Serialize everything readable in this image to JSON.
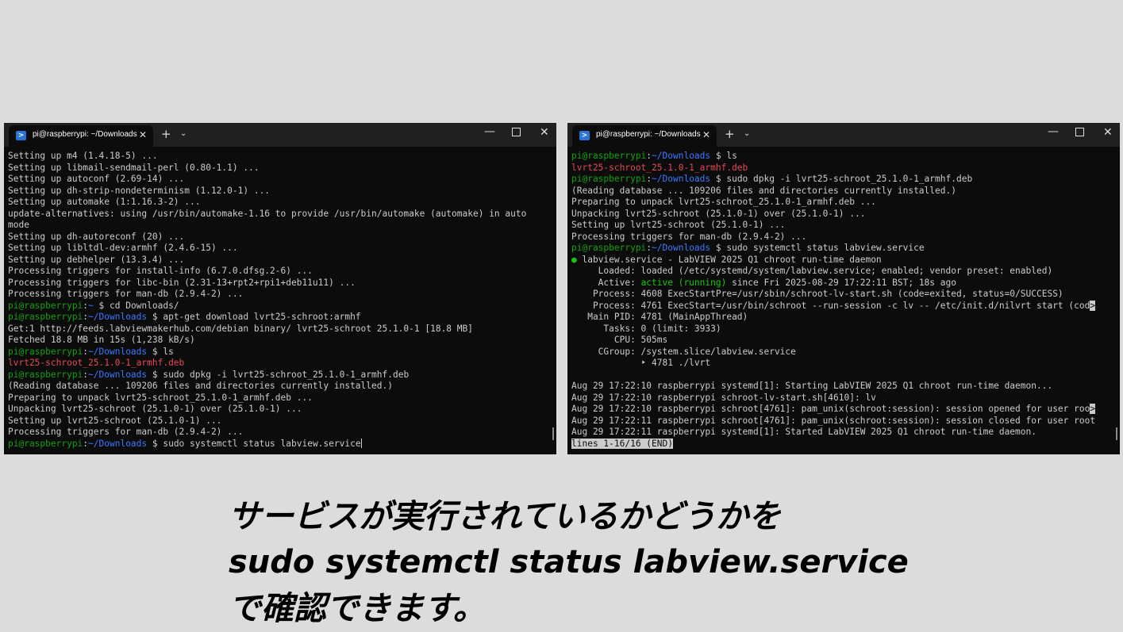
{
  "left_window": {
    "tab_title": "pi@raspberrypi: ~/Downloads",
    "tab_close": "✕",
    "new_tab": "+",
    "tab_menu": "⌄",
    "lines": [
      [
        {
          "t": "Setting up m4 (1.4.18-5) ...",
          "c": "w"
        }
      ],
      [
        {
          "t": "Setting up libmail-sendmail-perl (0.80-1.1) ...",
          "c": "w"
        }
      ],
      [
        {
          "t": "Setting up autoconf (2.69-14) ...",
          "c": "w"
        }
      ],
      [
        {
          "t": "Setting up dh-strip-nondeterminism (1.12.0-1) ...",
          "c": "w"
        }
      ],
      [
        {
          "t": "Setting up automake (1:1.16.3-2) ...",
          "c": "w"
        }
      ],
      [
        {
          "t": "update-alternatives: using /usr/bin/automake-1.16 to provide /usr/bin/automake (automake) in auto",
          "c": "w"
        }
      ],
      [
        {
          "t": "mode",
          "c": "w"
        }
      ],
      [
        {
          "t": "Setting up dh-autoreconf (20) ...",
          "c": "w"
        }
      ],
      [
        {
          "t": "Setting up libltdl-dev:armhf (2.4.6-15) ...",
          "c": "w"
        }
      ],
      [
        {
          "t": "Setting up debhelper (13.3.4) ...",
          "c": "w"
        }
      ],
      [
        {
          "t": "Processing triggers for install-info (6.7.0.dfsg.2-6) ...",
          "c": "w"
        }
      ],
      [
        {
          "t": "Processing triggers for libc-bin (2.31-13+rpt2+rpi1+deb11u11) ...",
          "c": "w"
        }
      ],
      [
        {
          "t": "Processing triggers for man-db (2.9.4-2) ...",
          "c": "w"
        }
      ],
      [
        {
          "t": "pi@raspberrypi",
          "c": "g"
        },
        {
          "t": ":",
          "c": "w"
        },
        {
          "t": "~",
          "c": "b"
        },
        {
          "t": " $ cd Downloads/",
          "c": "w"
        }
      ],
      [
        {
          "t": "pi@raspberrypi",
          "c": "g"
        },
        {
          "t": ":",
          "c": "w"
        },
        {
          "t": "~/Downloads",
          "c": "b"
        },
        {
          "t": " $ apt-get download lvrt25-schroot:armhf",
          "c": "w"
        }
      ],
      [
        {
          "t": "Get:1 http://feeds.labviewmakerhub.com/debian binary/ lvrt25-schroot 25.1.0-1 [18.8 MB]",
          "c": "w"
        }
      ],
      [
        {
          "t": "Fetched 18.8 MB in 15s (1,238 kB/s)",
          "c": "w"
        }
      ],
      [
        {
          "t": "pi@raspberrypi",
          "c": "g"
        },
        {
          "t": ":",
          "c": "w"
        },
        {
          "t": "~/Downloads",
          "c": "b"
        },
        {
          "t": " $ ls",
          "c": "w"
        }
      ],
      [
        {
          "t": "lvrt25-schroot_25.1.0-1_armhf.deb",
          "c": "r"
        }
      ],
      [
        {
          "t": "pi@raspberrypi",
          "c": "g"
        },
        {
          "t": ":",
          "c": "w"
        },
        {
          "t": "~/Downloads",
          "c": "b"
        },
        {
          "t": " $ sudo dpkg -i lvrt25-schroot_25.1.0-1_armhf.deb",
          "c": "w"
        }
      ],
      [
        {
          "t": "(Reading database ... 109206 files and directories currently installed.)",
          "c": "w"
        }
      ],
      [
        {
          "t": "Preparing to unpack lvrt25-schroot_25.1.0-1_armhf.deb ...",
          "c": "w"
        }
      ],
      [
        {
          "t": "Unpacking lvrt25-schroot (25.1.0-1) over (25.1.0-1) ...",
          "c": "w"
        }
      ],
      [
        {
          "t": "Setting up lvrt25-schroot (25.1.0-1) ...",
          "c": "w"
        }
      ],
      [
        {
          "t": "Processing triggers for man-db (2.9.4-2) ...",
          "c": "w"
        }
      ],
      [
        {
          "t": "pi@raspberrypi",
          "c": "g"
        },
        {
          "t": ":",
          "c": "w"
        },
        {
          "t": "~/Downloads",
          "c": "b"
        },
        {
          "t": " $ sudo systemctl status labview.service",
          "c": "w"
        },
        {
          "t": "",
          "c": "cursor"
        }
      ]
    ]
  },
  "right_window": {
    "tab_title": "pi@raspberrypi: ~/Downloads",
    "tab_close": "✕",
    "new_tab": "+",
    "tab_menu": "⌄",
    "lines": [
      [
        {
          "t": "pi@raspberrypi",
          "c": "g"
        },
        {
          "t": ":",
          "c": "w"
        },
        {
          "t": "~/Downloads",
          "c": "b"
        },
        {
          "t": " $ ls",
          "c": "w"
        }
      ],
      [
        {
          "t": "lvrt25-schroot_25.1.0-1_armhf.deb",
          "c": "r"
        }
      ],
      [
        {
          "t": "pi@raspberrypi",
          "c": "g"
        },
        {
          "t": ":",
          "c": "w"
        },
        {
          "t": "~/Downloads",
          "c": "b"
        },
        {
          "t": " $ sudo dpkg -i lvrt25-schroot_25.1.0-1_armhf.deb",
          "c": "w"
        }
      ],
      [
        {
          "t": "(Reading database ... 109206 files and directories currently installed.)",
          "c": "w"
        }
      ],
      [
        {
          "t": "Preparing to unpack lvrt25-schroot_25.1.0-1_armhf.deb ...",
          "c": "w"
        }
      ],
      [
        {
          "t": "Unpacking lvrt25-schroot (25.1.0-1) over (25.1.0-1) ...",
          "c": "w"
        }
      ],
      [
        {
          "t": "Setting up lvrt25-schroot (25.1.0-1) ...",
          "c": "w"
        }
      ],
      [
        {
          "t": "Processing triggers for man-db (2.9.4-2) ...",
          "c": "w"
        }
      ],
      [
        {
          "t": "pi@raspberrypi",
          "c": "g"
        },
        {
          "t": ":",
          "c": "w"
        },
        {
          "t": "~/Downloads",
          "c": "b"
        },
        {
          "t": " $ sudo systemctl status labview.service",
          "c": "w"
        }
      ],
      [
        {
          "t": "●",
          "c": "dot"
        },
        {
          "t": " labview.service - LabVIEW 2025 Q1 chroot run-time daemon",
          "c": "w"
        }
      ],
      [
        {
          "t": "     Loaded: loaded (/etc/systemd/system/labview.service; enabled; vendor preset: enabled)",
          "c": "w"
        }
      ],
      [
        {
          "t": "     Active: ",
          "c": "w"
        },
        {
          "t": "active (running)",
          "c": "dot"
        },
        {
          "t": " since Fri 2025-08-29 17:22:11 BST; 18s ago",
          "c": "w"
        }
      ],
      [
        {
          "t": "    Process: 4608 ExecStartPre=/usr/sbin/schroot-lv-start.sh (code=exited, status=0/SUCCESS)",
          "c": "w"
        }
      ],
      [
        {
          "t": "    Process: 4761 ExecStart=/usr/bin/schroot --run-session -c lv -- /etc/init.d/nilvrt start (cod",
          "c": "w"
        },
        {
          "t": ">",
          "c": "inv"
        }
      ],
      [
        {
          "t": "   Main PID: 4781 (MainAppThread)",
          "c": "w"
        }
      ],
      [
        {
          "t": "      Tasks: 0 (limit: 3933)",
          "c": "w"
        }
      ],
      [
        {
          "t": "        CPU: 505ms",
          "c": "w"
        }
      ],
      [
        {
          "t": "     CGroup: /system.slice/labview.service",
          "c": "w"
        }
      ],
      [
        {
          "t": "             ‣ 4781 ./lvrt",
          "c": "w"
        }
      ],
      [
        {
          "t": "",
          "c": "w"
        }
      ],
      [
        {
          "t": "Aug 29 17:22:10 raspberrypi systemd[1]: Starting LabVIEW 2025 Q1 chroot run-time daemon...",
          "c": "w"
        }
      ],
      [
        {
          "t": "Aug 29 17:22:10 raspberrypi schroot-lv-start.sh[4610]: lv",
          "c": "w"
        }
      ],
      [
        {
          "t": "Aug 29 17:22:10 raspberrypi schroot[4761]: pam_unix(schroot:session): session opened for user roo",
          "c": "w"
        },
        {
          "t": ">",
          "c": "inv"
        }
      ],
      [
        {
          "t": "Aug 29 17:22:11 raspberrypi schroot[4761]: pam_unix(schroot:session): session closed for user root",
          "c": "w"
        }
      ],
      [
        {
          "t": "Aug 29 17:22:11 raspberrypi systemd[1]: Started LabVIEW 2025 Q1 chroot run-time daemon.",
          "c": "w"
        }
      ],
      [
        {
          "t": "lines 1-16/16 (END)",
          "c": "inv"
        }
      ]
    ]
  },
  "caption": {
    "line1": "サービスが実行されているかどうかを",
    "line2": "sudo systemctl status labview.service",
    "line3": "で確認できます。"
  },
  "colors": {
    "background": "#dcdcdc",
    "terminal_bg": "#0c0c0c",
    "prompt_user": "#13a10e",
    "prompt_path": "#3b78ff",
    "deb_file": "#e74856",
    "active_status": "#16c60c"
  },
  "icons": {
    "tab_icon": "powershell-icon",
    "window_controls": [
      "minimize-icon",
      "maximize-icon",
      "close-icon"
    ]
  }
}
